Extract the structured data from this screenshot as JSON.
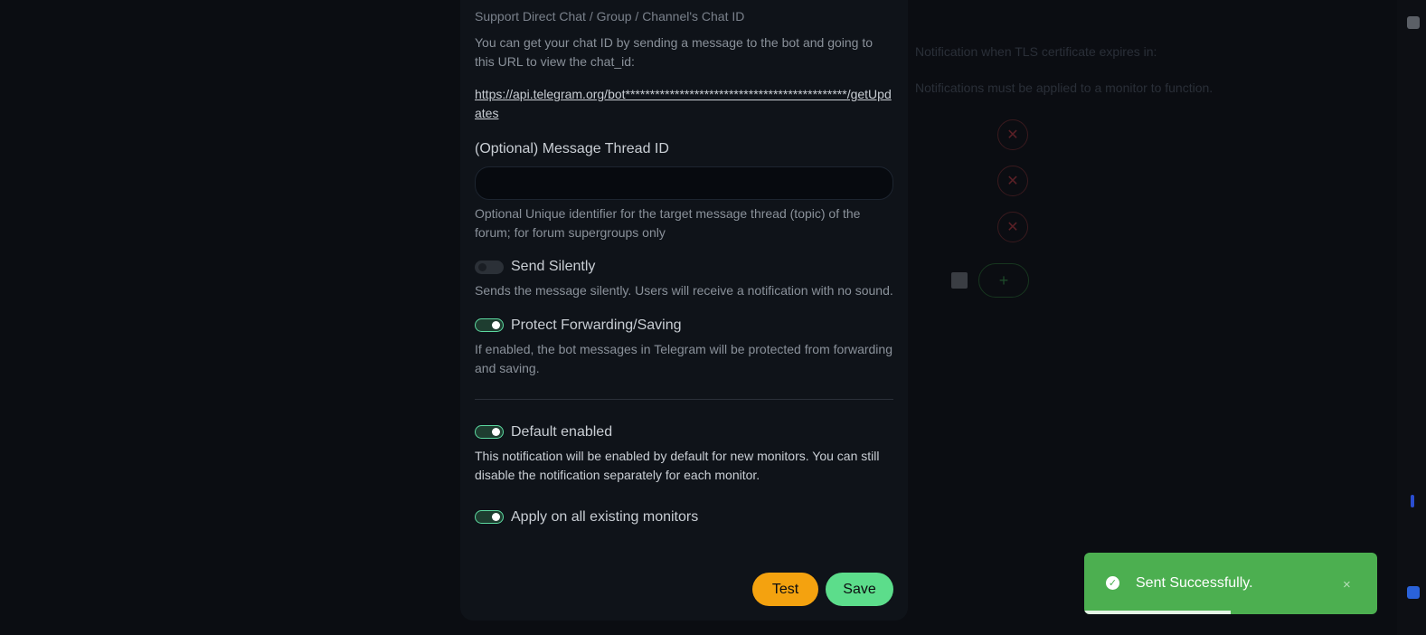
{
  "background": {
    "tls_hint": "Notification when TLS certificate expires in:",
    "monitor_hint": "Notifications must be applied to a monitor to function.",
    "delete_icon": "x-icon",
    "add_icon": "plus-icon"
  },
  "modal": {
    "chat_id_hint": "Support Direct Chat / Group / Channel's Chat ID",
    "chat_id_help": "You can get your chat ID by sending a message to the bot and going to this URL to view the chat_id:",
    "chat_id_url": "https://api.telegram.org/bot*********************************************/getUpdates",
    "thread_label": "(Optional) Message Thread ID",
    "thread_value": "",
    "thread_help": "Optional Unique identifier for the target message thread (topic) of the forum; for forum supergroups only",
    "send_silently": {
      "label": "Send Silently",
      "help": "Sends the message silently. Users will receive a notification with no sound.",
      "enabled": false
    },
    "protect_forwarding": {
      "label": "Protect Forwarding/Saving",
      "help": "If enabled, the bot messages in Telegram will be protected from forwarding and saving.",
      "enabled": true
    },
    "default_enabled": {
      "label": "Default enabled",
      "help": "This notification will be enabled by default for new monitors. You can still disable the notification separately for each monitor.",
      "enabled": true
    },
    "apply_existing": {
      "label": "Apply on all existing monitors",
      "enabled": true
    },
    "test_label": "Test",
    "save_label": "Save"
  },
  "toast": {
    "message": "Sent Successfully.",
    "close_symbol": "×",
    "icon": "check-circle-icon",
    "progress": 0.5,
    "color": "#4caf50"
  },
  "colors": {
    "accent_toggle": "#5cd9a0",
    "test_button": "#f4a20f",
    "save_button": "#5cdd8b"
  }
}
